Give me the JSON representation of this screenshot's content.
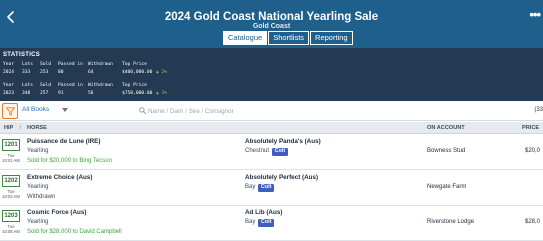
{
  "header": {
    "title": "2024 Gold Coast National Yearling Sale",
    "subtitle": "Gold Coast",
    "tabs": [
      {
        "label": "Catalogue",
        "active": true
      },
      {
        "label": "Shortlists",
        "active": false
      },
      {
        "label": "Reporting",
        "active": false
      }
    ],
    "more_glyph": "•••"
  },
  "statistics": {
    "title": "STATISTICS",
    "columns": [
      "Year",
      "Lots",
      "Sold",
      "Passed in",
      "Withdrawn",
      "Top Price"
    ],
    "rows": [
      {
        "year": "2024",
        "lots": "333",
        "sold": "253",
        "passed_in": "80",
        "withdrawn": "64",
        "top_price": "$400,000.00",
        "change": "▲ 2%"
      },
      {
        "year": "2023",
        "lots": "348",
        "sold": "257",
        "passed_in": "91",
        "withdrawn": "56",
        "top_price": "$750,000.00",
        "change": "▲ 1%"
      }
    ]
  },
  "filter": {
    "books_label": "All Books",
    "search_placeholder": "Name / Dam / Sire / Consignor",
    "count": "(33"
  },
  "table": {
    "headers": {
      "hip": "HIP",
      "sort": "↑",
      "horse": "HORSE",
      "account": "ON ACCOUNT",
      "price": "PRICE"
    },
    "rows": [
      {
        "lot": "1201",
        "day": "Tue",
        "time": "10:01 AM",
        "horse": "Puissance de Lune (IRE)",
        "age": "Yearling",
        "status": "Sold for $20,000 to Bing Tecson",
        "status_type": "sold",
        "dam": "Absolutely Panda's (Aus)",
        "color": "Chestnut",
        "sex": "Colt",
        "account": "Bowness Stud",
        "price": "$20,0"
      },
      {
        "lot": "1202",
        "day": "Tue",
        "time": "10:03 AM",
        "horse": "Extreme Choice (Aus)",
        "age": "Yearling",
        "status": "Withdrawn",
        "status_type": "withdrawn",
        "dam": "Absolutely Perfect (Aus)",
        "color": "Bay",
        "sex": "Colt",
        "account": "Newgate Farm",
        "price": ""
      },
      {
        "lot": "1203",
        "day": "Tue",
        "time": "10:05 AM",
        "horse": "Cosmic Force (Aus)",
        "age": "Yearling",
        "status": "Sold for $28,000 to David Campbell",
        "status_type": "sold",
        "dam": "Ad Lib (Aus)",
        "color": "Bay",
        "sex": "Colt",
        "account": "Riverstone Lodge",
        "price": "$28,0"
      }
    ]
  },
  "colors": {
    "header_bg": "#1f5f8b",
    "stats_bg": "#243a52",
    "sold_green": "#3fa33f",
    "colt_badge": "#3f5ebf",
    "filter_orange": "#f07b1c"
  }
}
